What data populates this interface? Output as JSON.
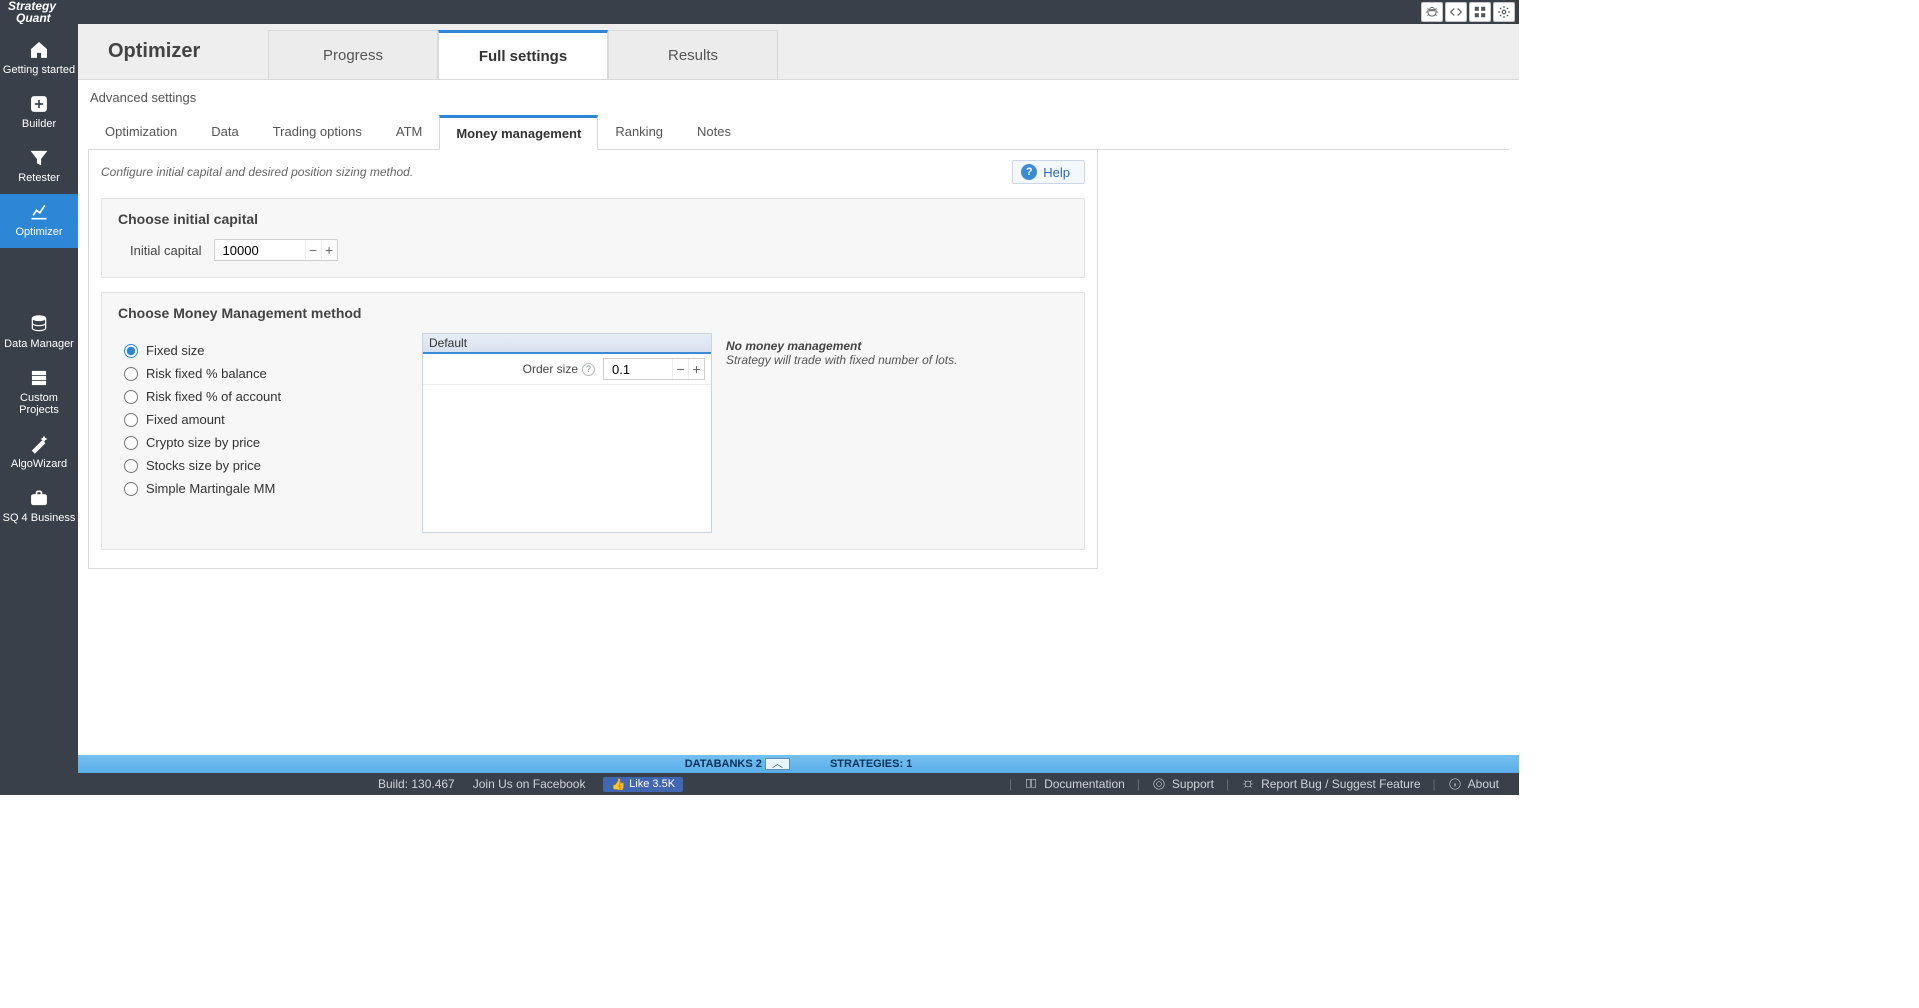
{
  "brand": {
    "line1": "Strategy",
    "line2": "Quant"
  },
  "topbar_icons": [
    "bug",
    "code",
    "grid",
    "gear"
  ],
  "sidebar": {
    "items": [
      {
        "label": "Getting started"
      },
      {
        "label": "Builder"
      },
      {
        "label": "Retester"
      },
      {
        "label": "Optimizer"
      },
      {
        "label": "Data Manager"
      },
      {
        "label": "Custom Projects"
      },
      {
        "label": "AlgoWizard"
      },
      {
        "label": "SQ 4 Business"
      }
    ],
    "active_index": 3
  },
  "page": {
    "title": "Optimizer"
  },
  "main_tabs": {
    "items": [
      "Progress",
      "Full settings",
      "Results"
    ],
    "active_index": 1
  },
  "breadcrumb": "Advanced settings",
  "sub_tabs": {
    "items": [
      "Optimization",
      "Data",
      "Trading options",
      "ATM",
      "Money management",
      "Ranking",
      "Notes"
    ],
    "active_index": 4
  },
  "description": "Configure initial capital and desired position sizing method.",
  "help_label": "Help",
  "capital_panel": {
    "title": "Choose initial capital",
    "label": "Initial capital",
    "value": "10000"
  },
  "mm_panel": {
    "title": "Choose Money Management method",
    "options": [
      "Fixed size",
      "Risk fixed % balance",
      "Risk fixed % of account",
      "Fixed amount",
      "Crypto size by price",
      "Stocks size by price",
      "Simple Martingale MM"
    ],
    "selected_index": 0,
    "grid": {
      "header": "Default",
      "rows": [
        {
          "label": "Order size",
          "value": "0.1"
        }
      ]
    },
    "desc": {
      "title": "No money management",
      "sub": "Strategy will trade with fixed number of lots."
    }
  },
  "status": {
    "databanks_label": "DATABANKS",
    "databanks_count": "2",
    "strategies_label": "STRATEGIES:",
    "strategies_count": "1"
  },
  "footer": {
    "build_label": "Build: 130.467",
    "join_label": "Join Us on Facebook",
    "like_label": "Like 3.5K",
    "links": {
      "documentation": "Documentation",
      "support": "Support",
      "report": "Report Bug / Suggest Feature",
      "about": "About"
    }
  }
}
